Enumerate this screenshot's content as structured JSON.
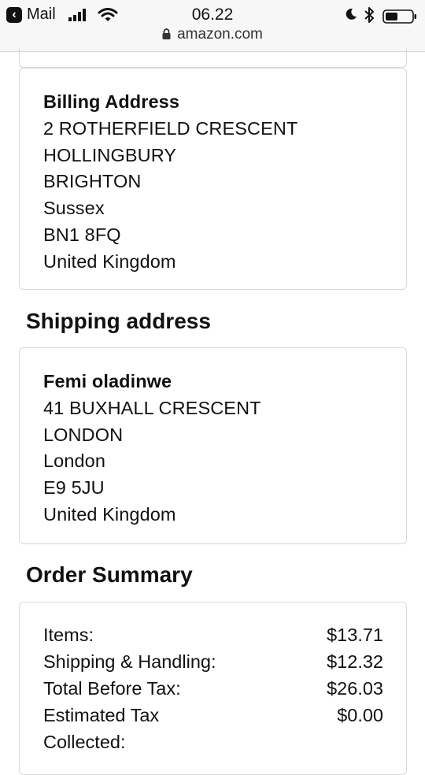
{
  "status_bar": {
    "carrier": "Mail",
    "time": "06.22",
    "url": "amazon.com"
  },
  "billing": {
    "heading": "Billing Address",
    "lines": [
      "2 ROTHERFIELD CRESCENT",
      "HOLLINGBURY",
      "BRIGHTON",
      "Sussex",
      "BN1 8FQ",
      "United Kingdom"
    ]
  },
  "shipping": {
    "heading": "Shipping address",
    "name": "Femi oladinwe",
    "lines": [
      "41 BUXHALL CRESCENT",
      "LONDON",
      "London",
      "E9 5JU",
      "United Kingdom"
    ]
  },
  "summary": {
    "heading": "Order Summary",
    "rows": [
      {
        "label": "Items:",
        "value": "$13.71"
      },
      {
        "label": "Shipping & Handling:",
        "value": "$12.32"
      },
      {
        "label": "Total Before Tax:",
        "value": "$26.03"
      },
      {
        "label": "Estimated Tax\nCollected:",
        "value": "$0.00"
      }
    ]
  }
}
